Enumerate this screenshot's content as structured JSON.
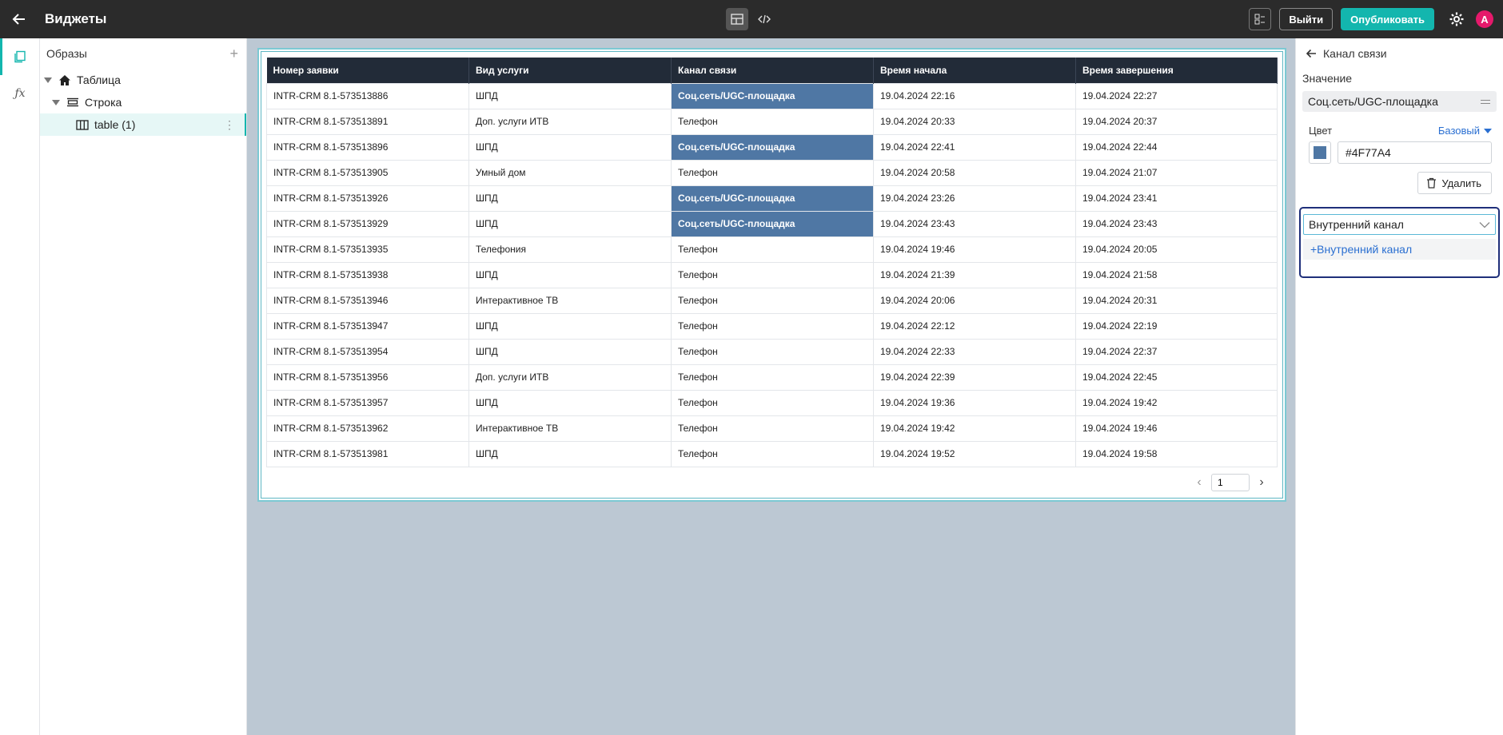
{
  "header": {
    "title": "Виджеты",
    "exit_label": "Выйти",
    "publish_label": "Опубликовать",
    "avatar_letter": "A"
  },
  "tree": {
    "title": "Образы",
    "add_symbol": "+",
    "items": [
      {
        "label": "Таблица",
        "icon": "home-icon"
      },
      {
        "label": "Строка",
        "icon": "row-icon"
      },
      {
        "label": "table (1)",
        "icon": "table-icon"
      }
    ],
    "more_symbol": "⋮"
  },
  "grid": {
    "columns": [
      "Номер заявки",
      "Вид услуги",
      "Канал связи",
      "Время начала",
      "Время завершения"
    ],
    "rows": [
      {
        "id": "INTR-CRM 8.1-573513886",
        "service": "ШПД",
        "channel": "Соц.сеть/UGC-площадка",
        "start": "19.04.2024 22:16",
        "end": "19.04.2024 22:27",
        "hl": true
      },
      {
        "id": "INTR-CRM 8.1-573513891",
        "service": "Доп. услуги ИТВ",
        "channel": "Телефон",
        "start": "19.04.2024 20:33",
        "end": "19.04.2024 20:37",
        "hl": false
      },
      {
        "id": "INTR-CRM 8.1-573513896",
        "service": "ШПД",
        "channel": "Соц.сеть/UGC-площадка",
        "start": "19.04.2024 22:41",
        "end": "19.04.2024 22:44",
        "hl": true
      },
      {
        "id": "INTR-CRM 8.1-573513905",
        "service": "Умный дом",
        "channel": "Телефон",
        "start": "19.04.2024 20:58",
        "end": "19.04.2024 21:07",
        "hl": false
      },
      {
        "id": "INTR-CRM 8.1-573513926",
        "service": "ШПД",
        "channel": "Соц.сеть/UGC-площадка",
        "start": "19.04.2024 23:26",
        "end": "19.04.2024 23:41",
        "hl": true
      },
      {
        "id": "INTR-CRM 8.1-573513929",
        "service": "ШПД",
        "channel": "Соц.сеть/UGC-площадка",
        "start": "19.04.2024 23:43",
        "end": "19.04.2024 23:43",
        "hl": true
      },
      {
        "id": "INTR-CRM 8.1-573513935",
        "service": "Телефония",
        "channel": "Телефон",
        "start": "19.04.2024 19:46",
        "end": "19.04.2024 20:05",
        "hl": false
      },
      {
        "id": "INTR-CRM 8.1-573513938",
        "service": "ШПД",
        "channel": "Телефон",
        "start": "19.04.2024 21:39",
        "end": "19.04.2024 21:58",
        "hl": false
      },
      {
        "id": "INTR-CRM 8.1-573513946",
        "service": "Интерактивное ТВ",
        "channel": "Телефон",
        "start": "19.04.2024 20:06",
        "end": "19.04.2024 20:31",
        "hl": false
      },
      {
        "id": "INTR-CRM 8.1-573513947",
        "service": "ШПД",
        "channel": "Телефон",
        "start": "19.04.2024 22:12",
        "end": "19.04.2024 22:19",
        "hl": false
      },
      {
        "id": "INTR-CRM 8.1-573513954",
        "service": "ШПД",
        "channel": "Телефон",
        "start": "19.04.2024 22:33",
        "end": "19.04.2024 22:37",
        "hl": false
      },
      {
        "id": "INTR-CRM 8.1-573513956",
        "service": "Доп. услуги ИТВ",
        "channel": "Телефон",
        "start": "19.04.2024 22:39",
        "end": "19.04.2024 22:45",
        "hl": false
      },
      {
        "id": "INTR-CRM 8.1-573513957",
        "service": "ШПД",
        "channel": "Телефон",
        "start": "19.04.2024 19:36",
        "end": "19.04.2024 19:42",
        "hl": false
      },
      {
        "id": "INTR-CRM 8.1-573513962",
        "service": "Интерактивное ТВ",
        "channel": "Телефон",
        "start": "19.04.2024 19:42",
        "end": "19.04.2024 19:46",
        "hl": false
      },
      {
        "id": "INTR-CRM 8.1-573513981",
        "service": "ШПД",
        "channel": "Телефон",
        "start": "19.04.2024 19:52",
        "end": "19.04.2024 19:58",
        "hl": false
      }
    ],
    "highlight_color": "#4F77A4",
    "page_value": "1",
    "prev_symbol": "‹",
    "next_symbol": "›"
  },
  "panel": {
    "title": "Канал связи",
    "value_label": "Значение",
    "value": "Соц.сеть/UGC-площадка",
    "color_label": "Цвет",
    "color_mode": "Базовый",
    "color_hex": "#4F77A4",
    "delete_label": "Удалить",
    "select_value": "Внутренний канал",
    "add_option_label": "+Внутренний канал"
  },
  "colors": {
    "accent": "#13b6ae",
    "topbar": "#2b2b2b",
    "header_row": "#222b38",
    "canvas": "#bcc8d3",
    "avatar": "#e5196b",
    "link": "#2a6fd1"
  }
}
